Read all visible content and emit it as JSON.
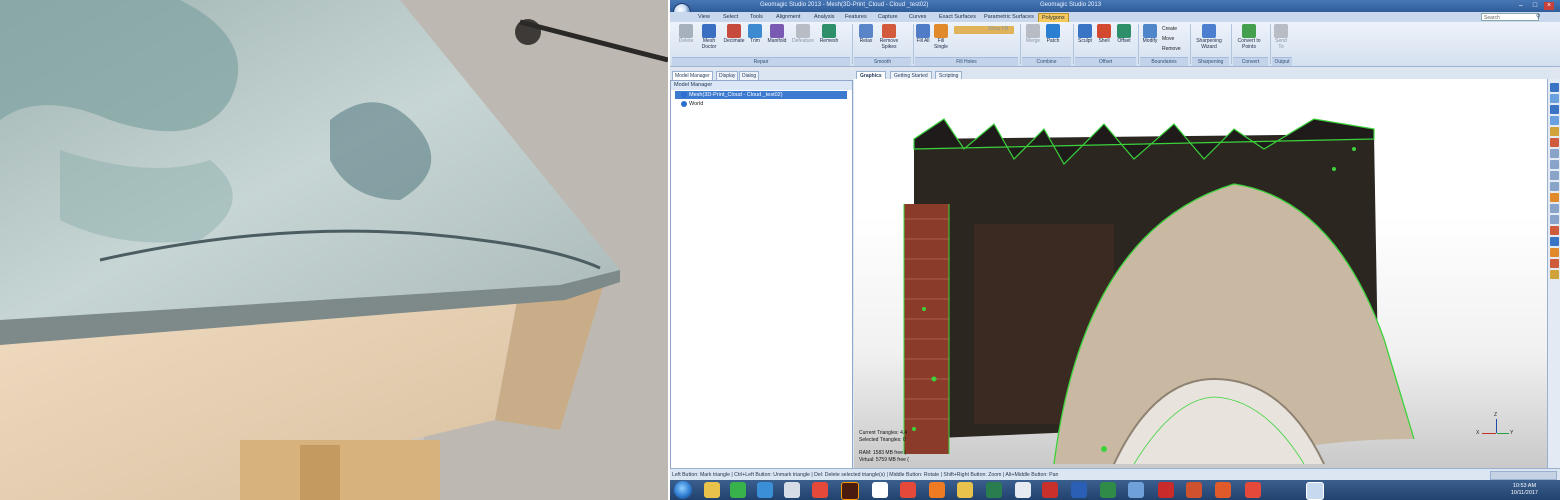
{
  "app": {
    "title": "Geomagic Studio 2013 - Mesh(3D-Print_Cloud - Cloud _test02)",
    "title_mid": "Geomagic Studio 2013"
  },
  "menu_tabs": [
    "View",
    "Select",
    "Tools",
    "Alignment",
    "Analysis",
    "Features",
    "Capture",
    "Curves",
    "Exact Surfaces",
    "Parametric Surfaces",
    "Polygons"
  ],
  "active_tab": "Polygons",
  "search_placeholder": "Search",
  "ribbon": {
    "buttons": [
      {
        "label": "Delete",
        "disabled": true,
        "color": "#9aa4b3"
      },
      {
        "label": "Mesh Doctor",
        "disabled": false,
        "color": "#3b6fc2"
      },
      {
        "label": "Decimate",
        "disabled": false,
        "color": "#c64b3c"
      },
      {
        "label": "Trim",
        "disabled": false,
        "color": "#3d8ad1"
      },
      {
        "label": "Manifold",
        "disabled": false,
        "color": "#7b5ab3"
      },
      {
        "label": "Defeature",
        "disabled": true,
        "color": "#a8adb7"
      },
      {
        "label": "Remesh",
        "disabled": false,
        "color": "#2e8f6b"
      },
      {
        "label": "Relax",
        "disabled": false,
        "color": "#5a86c9"
      },
      {
        "label": "Remove Spikes",
        "disabled": false,
        "color": "#d35a3c"
      },
      {
        "label": "Fill All",
        "disabled": false,
        "color": "#4f7bc7"
      },
      {
        "label": "Fill Single",
        "disabled": false,
        "color": "#e08a2c"
      },
      {
        "label": "Merge",
        "disabled": true,
        "color": "#a8adb7"
      },
      {
        "label": "Patch",
        "disabled": false,
        "color": "#2b7fd3"
      },
      {
        "label": "Sculpt",
        "disabled": false,
        "color": "#3a74c4"
      },
      {
        "label": "Shell",
        "disabled": false,
        "color": "#d2492f"
      },
      {
        "label": "Offset",
        "disabled": false,
        "color": "#2e8f6b"
      },
      {
        "label": "Modify",
        "disabled": false,
        "color": "#4e86c9"
      },
      {
        "label": "Sharpening Wizard",
        "disabled": false,
        "color": "#4d7fd0"
      },
      {
        "label": "Convert to Points",
        "disabled": false,
        "color": "#44a04e"
      },
      {
        "label": "Send To",
        "disabled": true,
        "color": "#a8adb7"
      }
    ],
    "small_buttons": [
      "Show Fill",
      "Create",
      "Move",
      "Remove"
    ],
    "groups": [
      "Repair",
      "Smooth",
      "Fill Holes",
      "Combine",
      "Offset",
      "Boundaries",
      "Sharpening",
      "Convert",
      "Output"
    ]
  },
  "model_manager": {
    "tabs": [
      "Model Manager",
      "Display",
      "Dialog"
    ],
    "header": "Model Manager",
    "items": [
      "Mesh(3D-Print_Cloud - Cloud _test02)",
      "World"
    ]
  },
  "graphics_tabs": [
    "Graphics",
    "Getting Started",
    "Scripting"
  ],
  "viewport_info": {
    "current_triangles": "Current Triangles: 4.4",
    "selected_triangles": "Selected Triangles: 0",
    "ram": "RAM: 1583 MB free (",
    "virtual": "Virtual: 5759 MB free ("
  },
  "axis_labels": {
    "z": "Z",
    "x": "X",
    "y": "Y"
  },
  "statusbar": "Left Button: Mark triangle | Ctrl+Left Button: Unmark triangle | Del: Delete selected triangle(s) | Middle Button: Rotate | Shift+Right Button: Zoom | Alt+Middle Button: Pan",
  "taskbar": {
    "icons": [
      "folder",
      "line",
      "telegram",
      "email",
      "chrome",
      "illustrator",
      "cc",
      "chrome2",
      "firefox",
      "folder2",
      "earth",
      "en",
      "opera",
      "word",
      "excel",
      "files",
      "acrobat",
      "powerpoint",
      "office",
      "chrome3",
      "geomagic"
    ],
    "time": "10:53 AM",
    "date": "10/11/2017"
  }
}
